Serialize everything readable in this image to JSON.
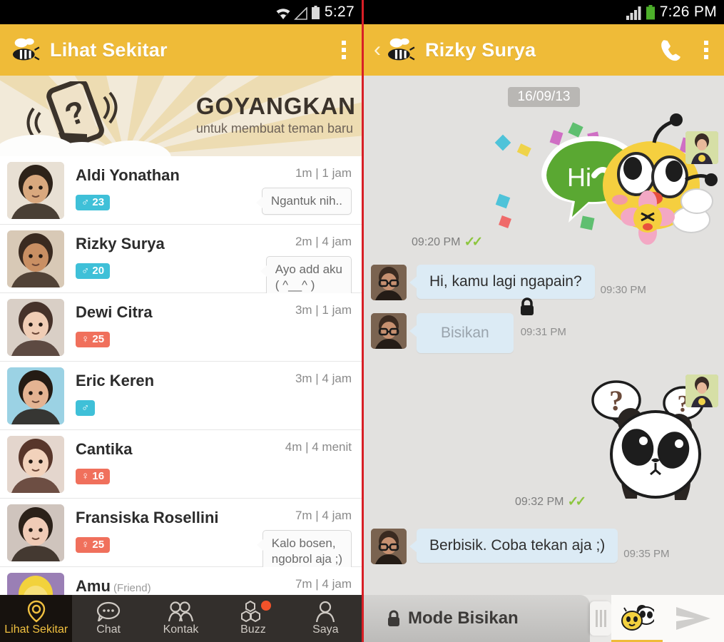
{
  "left": {
    "statusbar": {
      "time": "5:27",
      "icons": [
        "wifi-icon",
        "signal-icon",
        "battery-icon"
      ]
    },
    "actionbar": {
      "title": "Lihat Sekitar",
      "logo": "bee-logo",
      "overflow": "overflow-menu-icon"
    },
    "banner": {
      "title": "GOYANGKAN",
      "subtitle": "untuk membuat teman baru"
    },
    "contacts": [
      {
        "name": "Aldi Yonathan",
        "time": "1m | 1 jam",
        "gender": "m",
        "gender_symbol": "♂",
        "age": "23",
        "quote": "Ngantuk nih.."
      },
      {
        "name": "Rizky Surya",
        "time": "2m | 4 jam",
        "gender": "m",
        "gender_symbol": "♂",
        "age": "20",
        "quote": "Ayo add aku\n( ^__^ )"
      },
      {
        "name": "Dewi Citra",
        "time": "3m | 1 jam",
        "gender": "f",
        "gender_symbol": "♀",
        "age": "25",
        "quote": ""
      },
      {
        "name": "Eric Keren",
        "time": "3m | 4 jam",
        "gender": "m",
        "gender_symbol": "♂",
        "age": "",
        "quote": ""
      },
      {
        "name": "Cantika",
        "time": "4m | 4 menit",
        "gender": "f",
        "gender_symbol": "♀",
        "age": "16",
        "quote": ""
      },
      {
        "name": "Fransiska Rosellini",
        "time": "7m | 4 jam",
        "gender": "f",
        "gender_symbol": "♀",
        "age": "25",
        "quote": "Kalo bosen,\nngobrol aja ;)"
      },
      {
        "name": "Amu",
        "suffix": "(Friend)",
        "time": "7m | 4 jam",
        "gender": "f",
        "gender_symbol": "♀",
        "age": "",
        "quote": ""
      }
    ],
    "tabs": [
      {
        "label": "Lihat Sekitar",
        "icon": "location-pin-icon",
        "active": true,
        "badge": false
      },
      {
        "label": "Chat",
        "icon": "chat-bubble-icon",
        "active": false,
        "badge": false
      },
      {
        "label": "Kontak",
        "icon": "contacts-people-icon",
        "active": false,
        "badge": false
      },
      {
        "label": "Buzz",
        "icon": "hexagon-buzz-icon",
        "active": false,
        "badge": true
      },
      {
        "label": "Saya",
        "icon": "person-icon",
        "active": false,
        "badge": false
      }
    ]
  },
  "right": {
    "statusbar": {
      "time": "7:26 PM",
      "icons": [
        "signal-icon",
        "battery-icon"
      ]
    },
    "actionbar": {
      "title": "Rizky Surya",
      "back": "back-chevron-icon",
      "call": "phone-icon",
      "overflow": "overflow-menu-icon"
    },
    "date_chip": "16/09/13",
    "messages": [
      {
        "type": "sticker",
        "direction": "out",
        "sticker": "bee-hi-sticker",
        "time": "09:20 PM",
        "read": true
      },
      {
        "type": "text",
        "direction": "in",
        "text": "Hi, kamu lagi ngapain?",
        "time": "09:30 PM"
      },
      {
        "type": "whisper",
        "direction": "in",
        "text": "Bisikan",
        "time": "09:31 PM",
        "lock": "lock-icon"
      },
      {
        "type": "sticker",
        "direction": "out",
        "sticker": "panda-question-sticker",
        "time": "09:32 PM",
        "read": true
      },
      {
        "type": "text",
        "direction": "in",
        "text": "Berbisik. Coba tekan aja ;)",
        "time": "09:35 PM"
      }
    ],
    "inputbar": {
      "whisper_label": "Mode Bisikan",
      "lock_icon": "lock-icon",
      "drag_handle": "drag-handle",
      "sticker_button": "sticker-panda-icon",
      "send_button": "send-arrow-icon"
    }
  },
  "colors": {
    "accent": "#efbb38",
    "male_badge": "#3fc0d8",
    "female_badge": "#f0705c",
    "bubble": "#dcebf5",
    "chat_bg": "#e2e1df",
    "tabbar": "#332f2c",
    "tab_active_text": "#f0c040",
    "buzz_dot": "#f2522a",
    "divider": "#d81f26",
    "read_check": "#8dc63f"
  }
}
